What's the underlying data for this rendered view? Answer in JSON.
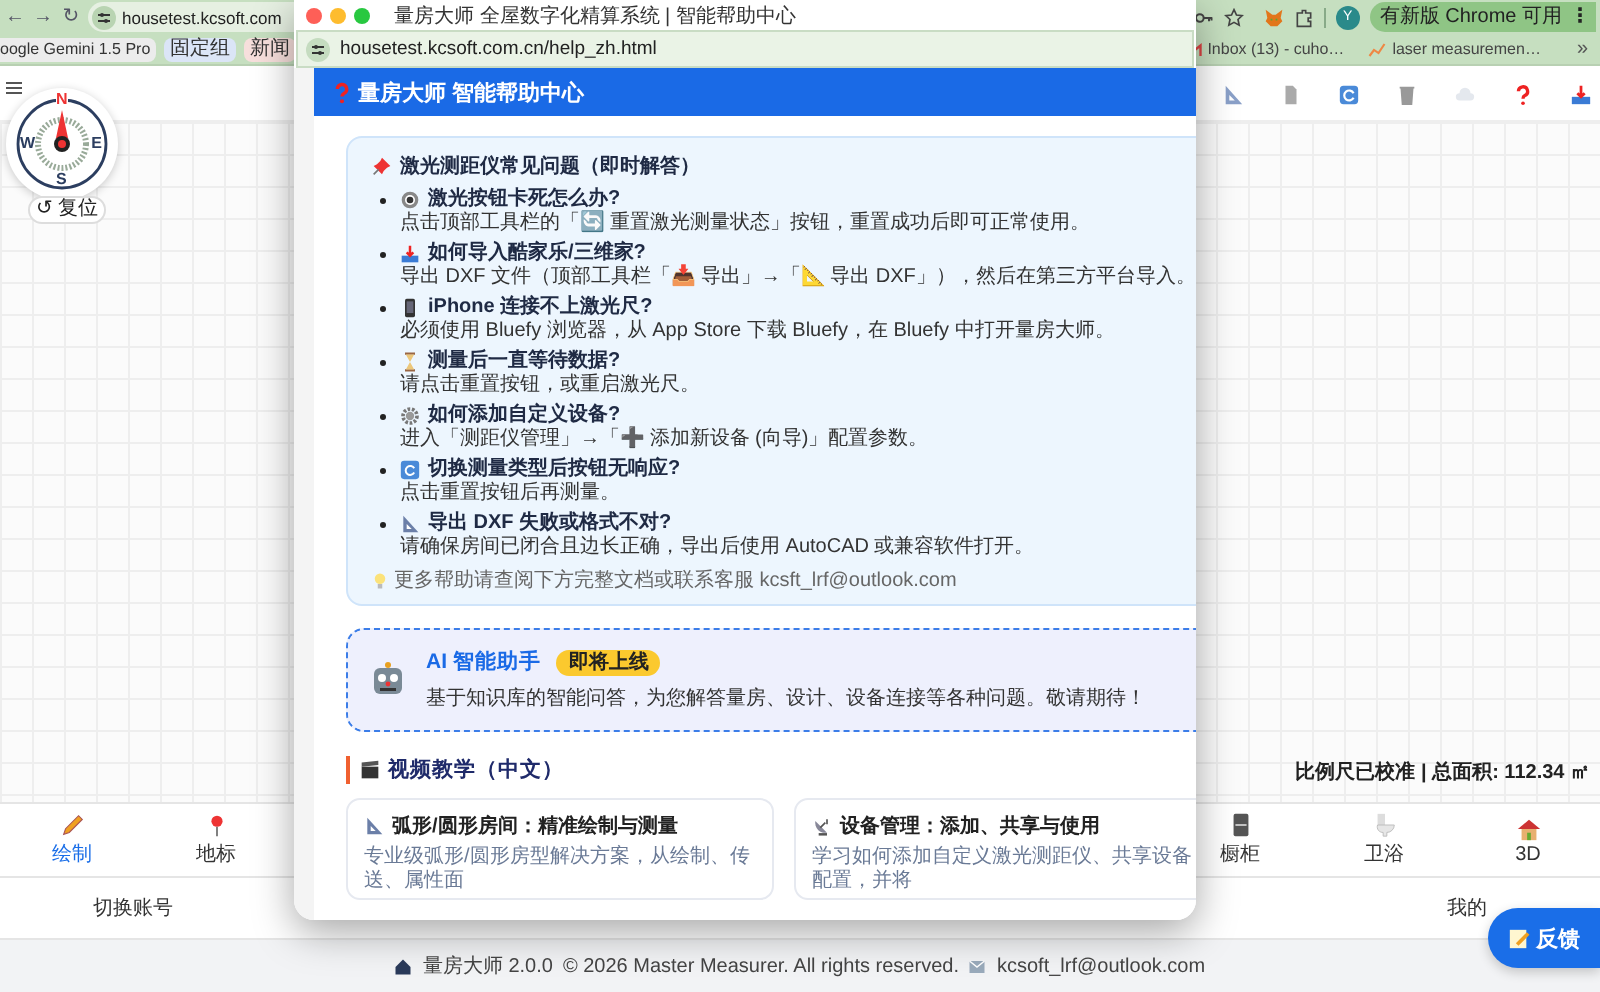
{
  "browser": {
    "nav_buttons": [
      "←",
      "→",
      "↻"
    ],
    "address": "housetest.kcsoft.com",
    "profile_initial": "Y",
    "update_button": "有新版 Chrome 可用",
    "update_menu": "⋮"
  },
  "bookmarks_left": [
    {
      "label": "oogle Gemini 1.5 Pro",
      "color": "#ececec"
    },
    {
      "label": "固定组",
      "color": "#dbe5f7"
    },
    {
      "label": "新闻",
      "color": "#f7dfdc"
    }
  ],
  "bookmarks_right": [
    "Inbox (13) - cuho…",
    "laser measuremen…"
  ],
  "bookmarks_more": "»",
  "compass": {
    "letters": [
      "N",
      "E",
      "S",
      "W"
    ],
    "reset_button": "↺ 复位"
  },
  "status": "比例尺已校准 | 总面积: 112.34 ㎡",
  "bottom_nav": {
    "left": [
      {
        "label": "绘制",
        "selected": true
      },
      {
        "label": "地标",
        "selected": false
      }
    ],
    "right": [
      {
        "label": "橱柜",
        "selected": false
      },
      {
        "label": "卫浴",
        "selected": false
      },
      {
        "label": "3D",
        "selected": false
      }
    ]
  },
  "account_row": [
    "切换账号",
    "我的"
  ],
  "feedback_button": "反馈",
  "footer": {
    "app": "量房大师 2.0.0",
    "copyright": "© 2026 Master Measurer. All rights reserved.",
    "email": "kcsoft_lrf@outlook.com"
  },
  "popup": {
    "title": "量房大师 全屋数字化精算系统 | 智能帮助中心",
    "url": "housetest.kcsoft.com.cn/help_zh.html",
    "header": "量房大师 智能帮助中心",
    "faq": {
      "title": "激光测距仪常见问题（即时解答）",
      "items": [
        {
          "question": "激光按钮卡死怎么办?",
          "answer": "点击顶部工具栏的「🔄 重置激光测量状态」按钮，重置成功后即可正常使用。"
        },
        {
          "question": "如何导入酷家乐/三维家?",
          "answer": "导出 DXF 文件（顶部工具栏「📥 导出」→「📐 导出 DXF」），然后在第三方平台导入。"
        },
        {
          "question": "iPhone 连接不上激光尺?",
          "answer": "必须使用 Bluefy 浏览器，从 App Store 下载 Bluefy，在 Bluefy 中打开量房大师。"
        },
        {
          "question": "测量后一直等待数据?",
          "answer": "请点击重置按钮，或重启激光尺。"
        },
        {
          "question": "如何添加自定义设备?",
          "answer": "进入「测距仪管理」→「➕ 添加新设备 (向导)」配置参数。"
        },
        {
          "question": "切换测量类型后按钮无响应?",
          "answer": "点击重置按钮后再测量。"
        },
        {
          "question": "导出 DXF 失败或格式不对?",
          "answer": "请确保房间已闭合且边长正确，导出后使用 AutoCAD 或兼容软件打开。"
        }
      ],
      "hint": "更多帮助请查阅下方完整文档或联系客服 kcsft_lrf@outlook.com"
    },
    "ai": {
      "title": "AI 智能助手",
      "badge": "即将上线",
      "description": "基于知识库的智能问答，为您解答量房、设计、设备连接等各种问题。敬请期待！"
    },
    "video_section": {
      "title": "视频教学（中文）",
      "cards": [
        {
          "title": "弧形/圆形房间：精准绘制与测量",
          "description": "专业级弧形/圆形房型解决方案，从绘制、传送、属性面"
        },
        {
          "title": "设备管理：添加、共享与使用",
          "description": "学习如何添加自定义激光测距仪、共享设备配置，并将"
        }
      ]
    }
  }
}
